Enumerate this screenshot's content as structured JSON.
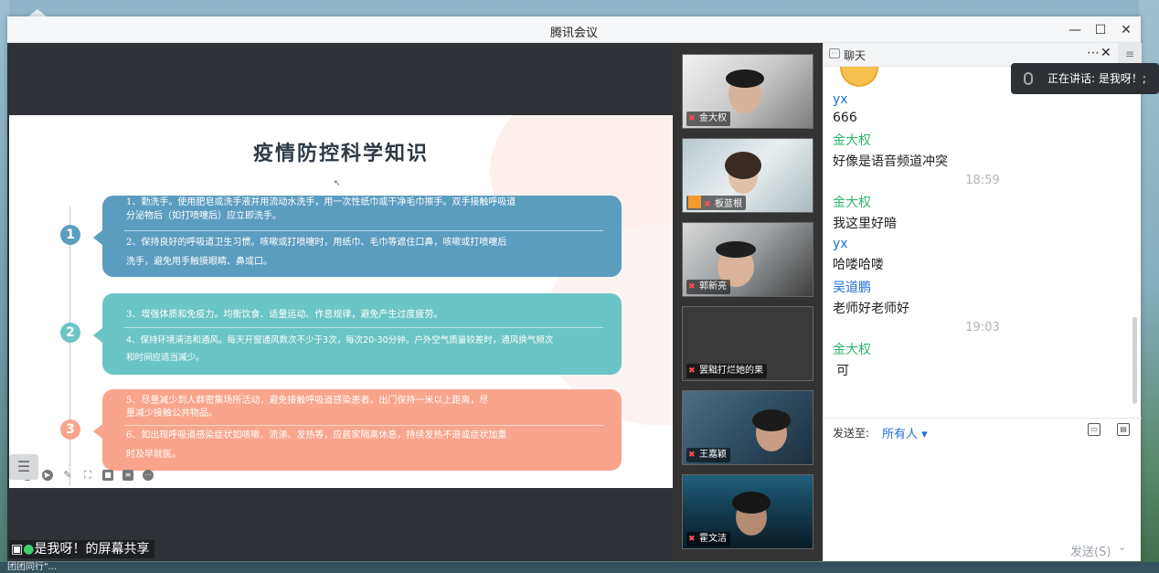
{
  "app": {
    "title": "腾讯会议"
  },
  "window_controls": {
    "minimize": "—",
    "maximize": "☐",
    "close": "✕"
  },
  "slide": {
    "title": "疫情防控科学知识",
    "sections": [
      {
        "number": "1",
        "color": "#5b9dbf",
        "lines": [
          "1、勤洗手。使用肥皂或洗手液并用流动水洗手，用一次性纸巾或干净毛巾擦手。双手接触呼吸道",
          "分泌物后（如打喷嚏后）应立即洗手。",
          "2、保持良好的呼吸道卫生习惯。咳嗽或打喷嚏时，用纸巾、毛巾等遮住口鼻，咳嗽或打喷嚏后",
          "洗手，避免用手触摸眼睛、鼻或口。"
        ]
      },
      {
        "number": "2",
        "color": "#6bc4c6",
        "lines": [
          "3、增强体质和免疫力。均衡饮食、适量运动、作息规律，避免产生过度疲劳。",
          "4、保持环境清洁和通风。每天开窗通风数次不少于3次，每次20-30分钟。户外空气质量较差时，通风换气频次",
          "和时间应适当减少。"
        ]
      },
      {
        "number": "3",
        "color": "#f9a48c",
        "lines": [
          "5、尽量减少到人群密集场所活动，避免接触呼吸道感染患者。出门保持一米以上距离，尽",
          "量减少接触公共物品。",
          "6、如出现呼吸道感染症状如咳嗽、流涕、发热等，应居家隔离休息，持续发热不退或症状加重",
          "时及早就医。"
        ]
      }
    ]
  },
  "share_caption": "是我呀！的屏幕共享",
  "participants": [
    {
      "name": "金大权"
    },
    {
      "name": "板蓝根"
    },
    {
      "name": "郭新亮"
    },
    {
      "name": "罢黜打烂她的果"
    },
    {
      "name": "王嘉颖"
    },
    {
      "name": "霍文洁"
    }
  ],
  "chat": {
    "title": "聊天",
    "more": "⋯",
    "close": "✕",
    "side": "≡",
    "messages": [
      {
        "name": "yx",
        "text": "666"
      },
      {
        "name": "金大权",
        "text": "好像是语音频道冲突"
      },
      {
        "time": "18:59"
      },
      {
        "name": "金大权",
        "text": "我这里好暗"
      },
      {
        "name": "yx",
        "text": "哈喽哈喽"
      },
      {
        "name": "吴道鹏",
        "text": "老师好老师好"
      },
      {
        "time": "19:03"
      },
      {
        "name": "金大权",
        "text": "可"
      }
    ],
    "send_to_label": "发送至:",
    "send_to_value": "所有人 ▾",
    "send_button": "发送(S)",
    "send_caret": "⌄"
  },
  "speaking_toast": "正在讲话: 是我呀！;",
  "desktop_bottom": "团团同行\"..."
}
